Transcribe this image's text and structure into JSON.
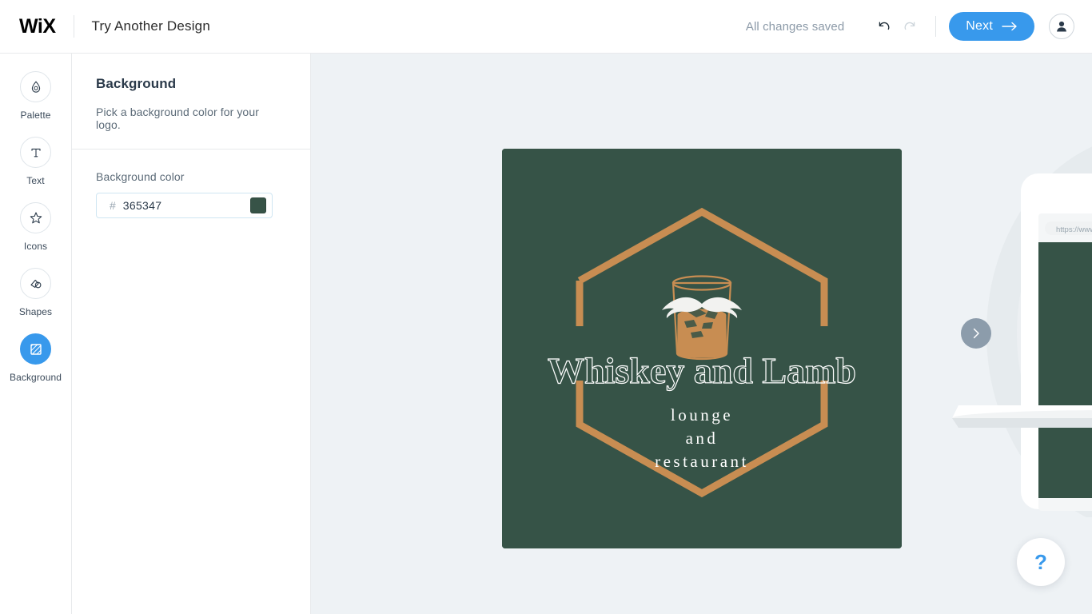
{
  "topbar": {
    "brand": "WiX",
    "title": "Try Another Design",
    "save_status": "All changes saved",
    "undo_icon": "undo-icon",
    "redo_icon": "redo-icon",
    "next_label": "Next",
    "next_arrow": "→",
    "avatar_icon": "user-avatar-icon",
    "accent_color": "#3899ec"
  },
  "sidebar": {
    "items": [
      {
        "id": "palette",
        "label": "Palette",
        "icon": "droplet-icon",
        "active": false
      },
      {
        "id": "text",
        "label": "Text",
        "icon": "text-t-icon",
        "active": false
      },
      {
        "id": "icons",
        "label": "Icons",
        "icon": "star-icon",
        "active": false
      },
      {
        "id": "shapes",
        "label": "Shapes",
        "icon": "shapes-icon",
        "active": false
      },
      {
        "id": "background",
        "label": "Background",
        "icon": "hatched-square-icon",
        "active": true
      }
    ]
  },
  "panel": {
    "title": "Background",
    "subtitle": "Pick a background color for your logo.",
    "field_label": "Background color",
    "hash_symbol": "#",
    "hex_value": "365347",
    "swatch_color": "#375347"
  },
  "canvas": {
    "background_color": "#eef2f5",
    "carousel_next_icon": "chevron-right-icon",
    "help_label": "?",
    "preview": {
      "url_text": "https://www.m",
      "screen_color": "#365347"
    }
  },
  "logo": {
    "background_color": "#365347",
    "frame_color": "#c88d52",
    "brand_name": "Whiskey and Lamb",
    "tagline_lines": [
      "lounge",
      "and",
      "restaurant"
    ],
    "text_color": "#ffffff",
    "emblem_icon": "whiskey-glass-moustache-icon",
    "glass_color": "#c88d52",
    "moustache_color": "#f2f2f0"
  }
}
